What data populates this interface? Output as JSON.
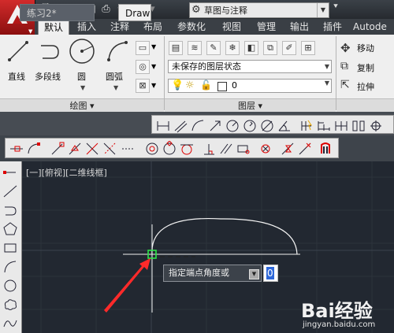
{
  "titlebar": {
    "workspace": "草图与注释"
  },
  "ribbon_tabs": [
    "默认",
    "插入",
    "注释",
    "布局",
    "参数化",
    "视图",
    "管理",
    "输出",
    "插件",
    "Autode"
  ],
  "draw_panel": {
    "line": "直线",
    "polyline": "多段线",
    "circle": "圆",
    "arc": "圆弧",
    "title": "绘图"
  },
  "layers_panel": {
    "state": "未保存的图层状态",
    "current_layer": "0",
    "title": "图层"
  },
  "modify_panel": {
    "move": "移动",
    "copy": "复制",
    "stretch": "拉伸"
  },
  "file_tabs": {
    "tab1": "练习2*",
    "tab2": "Draw"
  },
  "viewport": {
    "label": "[一][俯视][二维线框]"
  },
  "prompt": {
    "text": "指定端点角度或",
    "value": "0"
  },
  "watermark": {
    "logo": "Bai经验",
    "url": "jingyan.baidu.com"
  },
  "colors": {
    "canvas": "#222831",
    "arrow": "#ff2a2a",
    "osnap": "#2ee64a"
  }
}
